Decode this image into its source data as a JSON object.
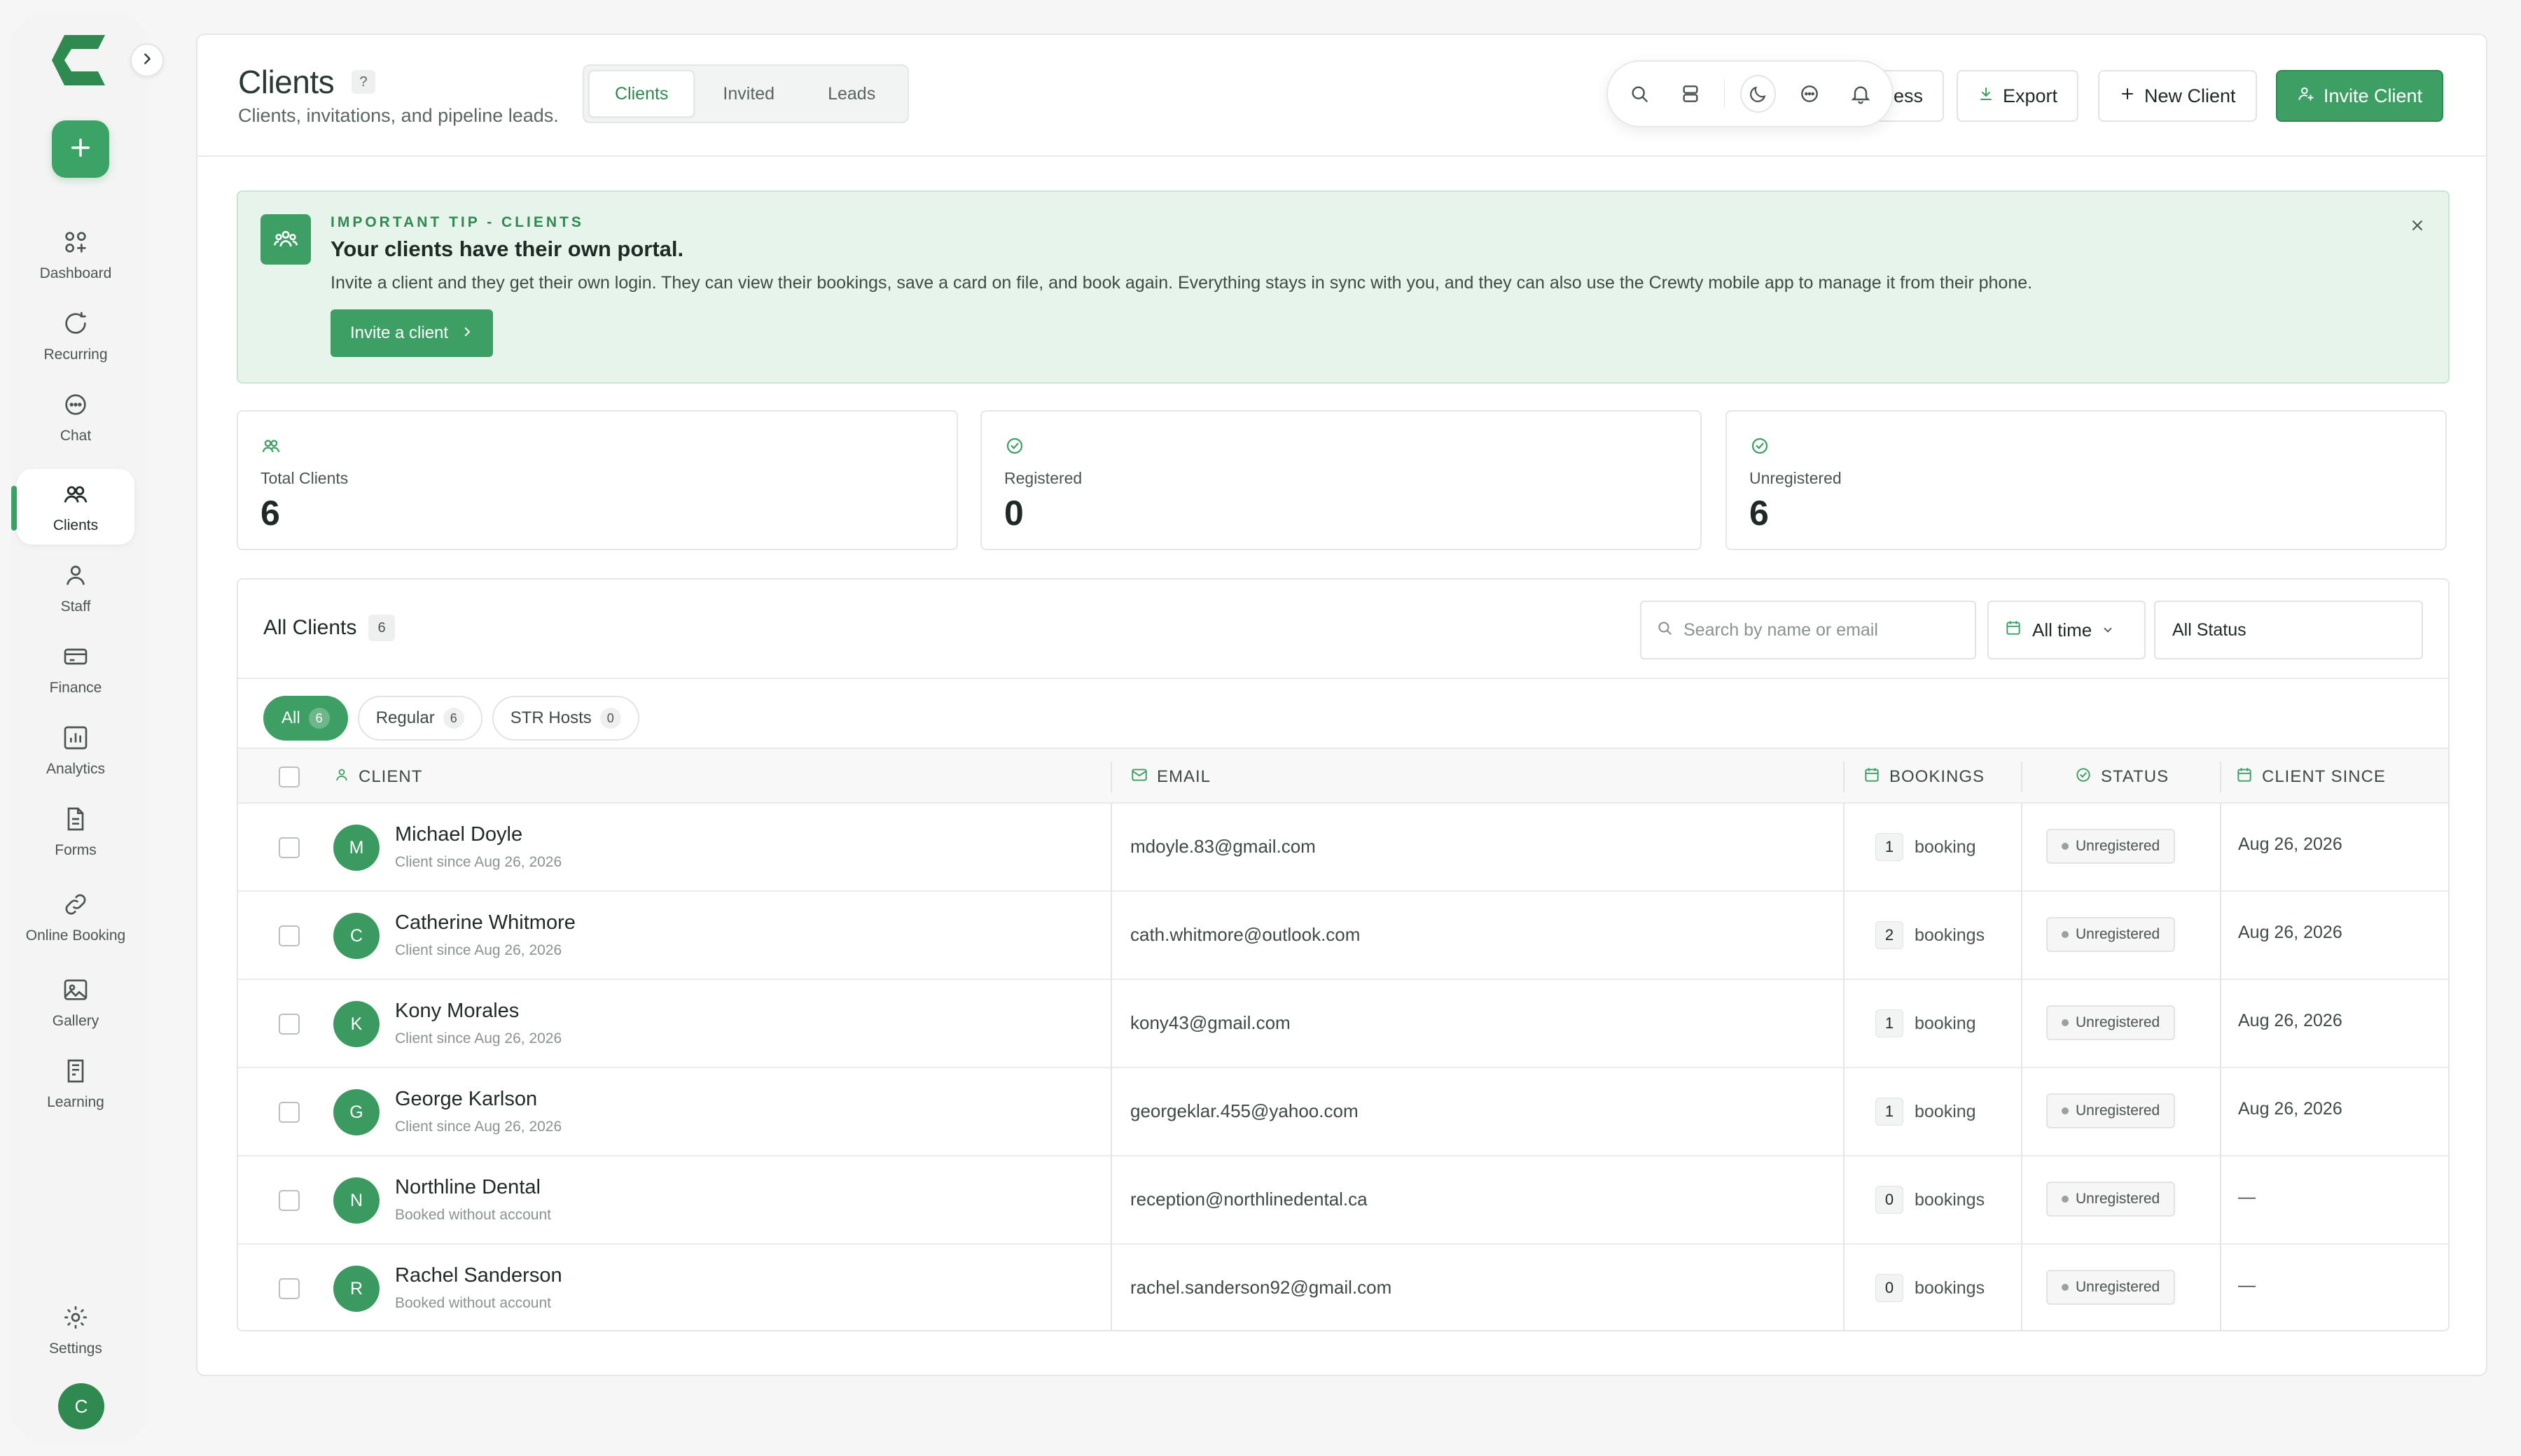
{
  "sidebar": {
    "items": [
      {
        "label": "Dashboard",
        "icon": "dashboard-icon"
      },
      {
        "label": "Recurring",
        "icon": "recurring-icon"
      },
      {
        "label": "Chat",
        "icon": "chat-icon"
      },
      {
        "label": "Clients",
        "icon": "clients-icon",
        "active": true
      },
      {
        "label": "Staff",
        "icon": "staff-icon"
      },
      {
        "label": "Finance",
        "icon": "finance-icon"
      },
      {
        "label": "Analytics",
        "icon": "analytics-icon"
      },
      {
        "label": "Forms",
        "icon": "forms-icon"
      },
      {
        "label": "Online Booking",
        "icon": "link-icon"
      },
      {
        "label": "Gallery",
        "icon": "gallery-icon"
      },
      {
        "label": "Learning",
        "icon": "learning-icon"
      }
    ],
    "settings_label": "Settings",
    "user_initial": "C"
  },
  "header": {
    "title": "Clients",
    "help": "?",
    "subtitle": "Clients, invitations, and pipeline leads.",
    "tabs": [
      {
        "label": "Clients",
        "active": true
      },
      {
        "label": "Invited"
      },
      {
        "label": "Leads"
      }
    ],
    "hidden_button_label": "ess",
    "export_label": "Export",
    "new_client_label": "New Client",
    "invite_client_label": "Invite Client"
  },
  "tip": {
    "overline": "IMPORTANT TIP - CLIENTS",
    "title": "Your clients have their own portal.",
    "body": "Invite a client and they get their own login. They can view their bookings, save a card on file, and book again. Everything stays in sync with you, and they can also use the Crewty mobile app to manage it from their phone.",
    "button": "Invite a client"
  },
  "stats": [
    {
      "label": "Total Clients",
      "value": "6"
    },
    {
      "label": "Registered",
      "value": "0"
    },
    {
      "label": "Unregistered",
      "value": "6"
    }
  ],
  "table": {
    "title": "All Clients",
    "count": "6",
    "search_placeholder": "Search by name or email",
    "time_filter": "All time",
    "status_filter": "All Status",
    "chips": [
      {
        "label": "All",
        "count": "6",
        "active": true
      },
      {
        "label": "Regular",
        "count": "6"
      },
      {
        "label": "STR Hosts",
        "count": "0"
      }
    ],
    "columns": {
      "client": "CLIENT",
      "email": "EMAIL",
      "bookings": "BOOKINGS",
      "status": "STATUS",
      "since": "CLIENT SINCE"
    },
    "rows": [
      {
        "initial": "M",
        "name": "Michael Doyle",
        "sub": "Client since Aug 26, 2026",
        "email": "mdoyle.83@gmail.com",
        "bookings": "1",
        "bookings_word": "booking",
        "status": "Unregistered",
        "since": "Aug 26, 2026"
      },
      {
        "initial": "C",
        "name": "Catherine Whitmore",
        "sub": "Client since Aug 26, 2026",
        "email": "cath.whitmore@outlook.com",
        "bookings": "2",
        "bookings_word": "bookings",
        "status": "Unregistered",
        "since": "Aug 26, 2026"
      },
      {
        "initial": "K",
        "name": "Kony Morales",
        "sub": "Client since Aug 26, 2026",
        "email": "kony43@gmail.com",
        "bookings": "1",
        "bookings_word": "booking",
        "status": "Unregistered",
        "since": "Aug 26, 2026"
      },
      {
        "initial": "G",
        "name": "George Karlson",
        "sub": "Client since Aug 26, 2026",
        "email": "georgeklar.455@yahoo.com",
        "bookings": "1",
        "bookings_word": "booking",
        "status": "Unregistered",
        "since": "Aug 26, 2026"
      },
      {
        "initial": "N",
        "name": "Northline Dental",
        "sub": "Booked without account",
        "email": "reception@northlinedental.ca",
        "bookings": "0",
        "bookings_word": "bookings",
        "status": "Unregistered",
        "since": "—"
      },
      {
        "initial": "R",
        "name": "Rachel Sanderson",
        "sub": "Booked without account",
        "email": "rachel.sanderson92@gmail.com",
        "bookings": "0",
        "bookings_word": "bookings",
        "status": "Unregistered",
        "since": "—"
      }
    ]
  },
  "colors": {
    "accent": "#3d9f63",
    "accent_dark": "#2f8a50",
    "tip_bg": "#e7f4eb"
  }
}
